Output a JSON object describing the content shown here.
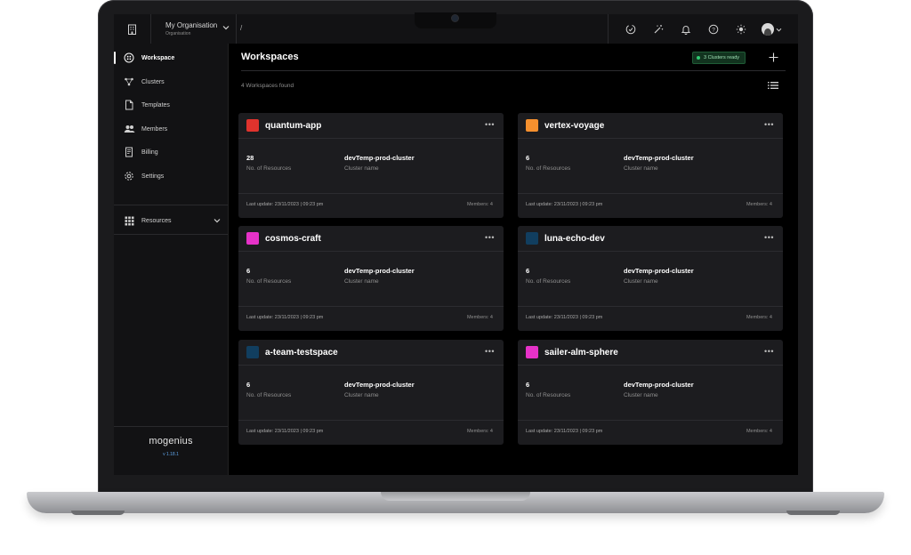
{
  "topbar": {
    "org_name": "My Organisation",
    "org_sub": "Organisation",
    "breadcrumb_sep": "/"
  },
  "sidebar": {
    "items": [
      {
        "label": "Workspace",
        "icon": "workspace-icon",
        "active": true
      },
      {
        "label": "Clusters",
        "icon": "clusters-icon"
      },
      {
        "label": "Templates",
        "icon": "templates-icon"
      },
      {
        "label": "Members",
        "icon": "members-icon"
      },
      {
        "label": "Billing",
        "icon": "billing-icon"
      },
      {
        "label": "Settings",
        "icon": "settings-icon"
      },
      {
        "label": "Resources",
        "icon": "resources-icon"
      }
    ],
    "brand": "mogenius",
    "version": "v 1.18.1"
  },
  "main": {
    "title": "Workspaces",
    "clusters_badge": "3 Clusters ready",
    "found_text": "4 Workspaces found"
  },
  "workspaces": [
    {
      "name": "quantum-app",
      "color": "#e0332d",
      "resources": "28",
      "resources_label": "No. of Resources",
      "cluster": "devTemp-prod-cluster",
      "cluster_label": "Cluster name",
      "last_update": "Last update: 23/11/2023 | 09:23 pm",
      "members": "Members: 4"
    },
    {
      "name": "vertex-voyage",
      "color": "#f5902e",
      "resources": "6",
      "resources_label": "No. of Resources",
      "cluster": "devTemp-prod-cluster",
      "cluster_label": "Cluster name",
      "last_update": "Last update: 23/11/2023 | 09:23 pm",
      "members": "Members: 4"
    },
    {
      "name": "cosmos-craft",
      "color": "#e632c8",
      "resources": "6",
      "resources_label": "No. of Resources",
      "cluster": "devTemp-prod-cluster",
      "cluster_label": "Cluster name",
      "last_update": "Last update: 23/11/2023 | 09:23 pm",
      "members": "Members: 4"
    },
    {
      "name": "luna-echo-dev",
      "color": "#113e5f",
      "resources": "6",
      "resources_label": "No. of Resources",
      "cluster": "devTemp-prod-cluster",
      "cluster_label": "Cluster name",
      "last_update": "Last update: 23/11/2023 | 09:23 pm",
      "members": "Members: 4"
    },
    {
      "name": "a-team-testspace",
      "color": "#113e5f",
      "resources": "6",
      "resources_label": "No. of Resources",
      "cluster": "devTemp-prod-cluster",
      "cluster_label": "Cluster name",
      "last_update": "Last update: 23/11/2023 | 09:23 pm",
      "members": "Members: 4"
    },
    {
      "name": "sailer-alm-sphere",
      "color": "#e632c8",
      "resources": "6",
      "resources_label": "No. of Resources",
      "cluster": "devTemp-prod-cluster",
      "cluster_label": "Cluster name",
      "last_update": "Last update: 23/11/2023 | 09:23 pm",
      "members": "Members: 4"
    }
  ],
  "colors": {
    "status_ok": "#2ecc71",
    "version_link": "#5ea2e6"
  }
}
